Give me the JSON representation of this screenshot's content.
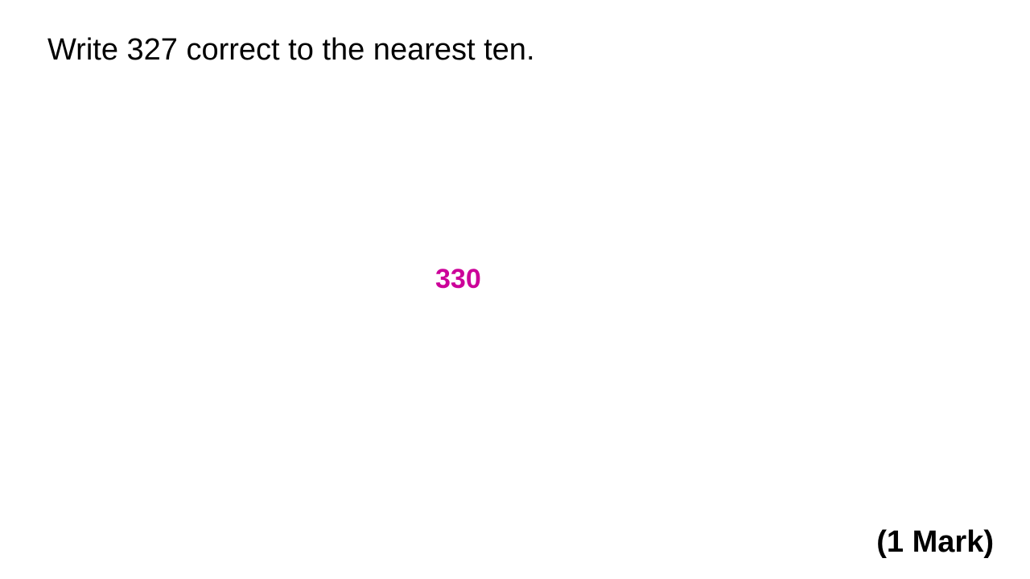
{
  "question": {
    "text": "Write 327 correct to the nearest ten."
  },
  "answer": {
    "text": "330",
    "color": "#cc0099"
  },
  "marks": {
    "text": "(1 Mark)"
  }
}
